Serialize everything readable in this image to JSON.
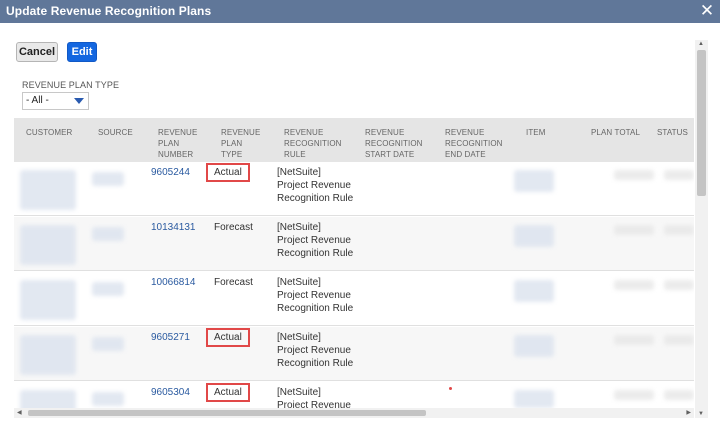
{
  "window": {
    "title": "Update Revenue Recognition Plans",
    "close_icon": "close-icon"
  },
  "toolbar": {
    "cancel_label": "Cancel",
    "edit_label": "Edit"
  },
  "filter": {
    "label": "REVENUE PLAN TYPE",
    "selected": "- All -"
  },
  "grid": {
    "headers": {
      "customer": "CUSTOMER",
      "source": "SOURCE",
      "plan_number": [
        "REVENUE",
        "PLAN",
        "NUMBER"
      ],
      "plan_type": [
        "REVENUE",
        "PLAN",
        "TYPE"
      ],
      "rule": [
        "REVENUE",
        "RECOGNITION",
        "RULE"
      ],
      "start_date": [
        "REVENUE",
        "RECOGNITION",
        "START DATE"
      ],
      "end_date": [
        "REVENUE",
        "RECOGNITION",
        "END DATE"
      ],
      "item": "ITEM",
      "plan_total": "PLAN TOTAL",
      "status": "STATUS"
    },
    "rows": [
      {
        "plan_number": "9605244",
        "plan_type": "Actual",
        "rule": [
          "[NetSuite]",
          "Project Revenue",
          "Recognition Rule"
        ]
      },
      {
        "plan_number": "10134131",
        "plan_type": "Forecast",
        "rule": [
          "[NetSuite]",
          "Project Revenue",
          "Recognition Rule"
        ]
      },
      {
        "plan_number": "10066814",
        "plan_type": "Forecast",
        "rule": [
          "[NetSuite]",
          "Project Revenue",
          "Recognition Rule"
        ]
      },
      {
        "plan_number": "9605271",
        "plan_type": "Actual",
        "rule": [
          "[NetSuite]",
          "Project Revenue",
          "Recognition Rule"
        ]
      },
      {
        "plan_number": "9605304",
        "plan_type": "Actual",
        "rule": [
          "[NetSuite]",
          "Project Revenue",
          ""
        ]
      }
    ]
  },
  "colors": {
    "titlebar": "#607799",
    "primary_button": "#1467e0",
    "link": "#2a5aa0",
    "highlight": "#e14848"
  }
}
